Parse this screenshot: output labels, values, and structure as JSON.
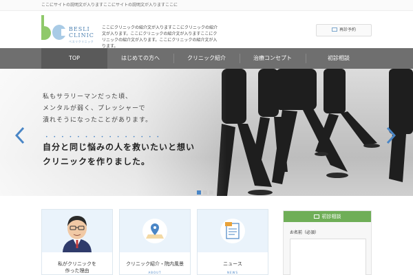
{
  "topbar": {
    "text": "ここにサイトの説明文が入りますここにサイトの説明文が入りますここに"
  },
  "header": {
    "logo_name_1": "BESLI",
    "logo_name_2": "CLINIC",
    "logo_sub": "ベスリクリニック",
    "desc": "ここにクリニックの紹介文が入りますここにクリニックの紹介文が入ります。ここにクリニックの紹介文が入りますここにクリニックの紹介文が入ります。ここにクリニックの紹介文が入ります。",
    "revisit_label": "再診予約"
  },
  "nav": {
    "items": [
      {
        "label": "TOP"
      },
      {
        "label": "はじめての方へ"
      },
      {
        "label": "クリニック紹介"
      },
      {
        "label": "治療コンセプト"
      },
      {
        "label": "初診相談"
      }
    ]
  },
  "hero": {
    "line1": "私もサラリーマンだった頃、",
    "line2": "メンタルが弱く、プレッシャーで",
    "line3": "潰れそうになったことがあります。",
    "dots": "•••••••••••••••",
    "title1": "自分と同じ悩みの人を救いたいと想い",
    "title2": "クリニックを作りました。"
  },
  "cards": [
    {
      "title1": "私がクリニックを",
      "title2": "作った理由",
      "sub": "",
      "icon": "doctor-avatar"
    },
    {
      "title1": "クリニック紹介・院内風景",
      "title2": "",
      "sub": "ABOUT",
      "icon": "map-pin-icon"
    },
    {
      "title1": "ニュース",
      "title2": "",
      "sub": "NEWS",
      "icon": "news-icon"
    }
  ],
  "sidebox": {
    "head": "初診相談",
    "label": "お名前（必須）"
  },
  "colors": {
    "nav_bg": "#6f6f6f",
    "accent_blue": "#4a86c6",
    "accent_green": "#6fae57"
  }
}
